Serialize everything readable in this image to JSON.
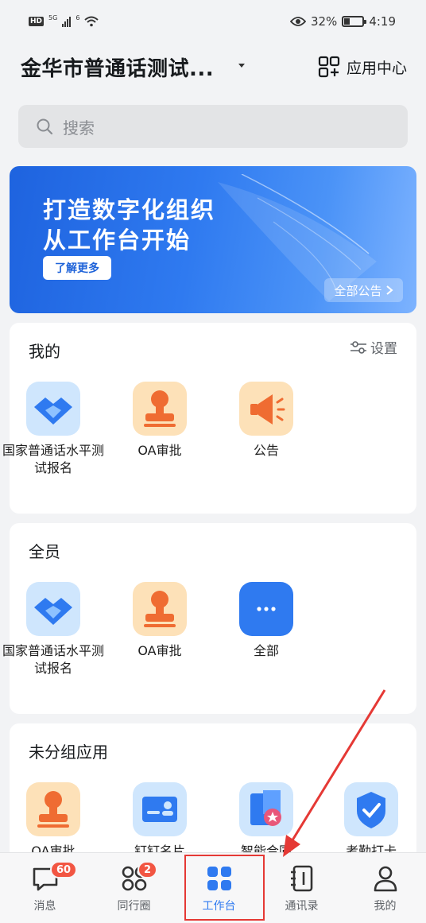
{
  "status_bar": {
    "hd": "HD",
    "sig1": "5G",
    "sig2": "6",
    "battery_text": "32%",
    "battery_level": 0.32,
    "time": "4:19"
  },
  "header": {
    "org_title": "金华市普通话测试...",
    "app_center_label": "应用中心"
  },
  "search": {
    "placeholder": "搜索"
  },
  "banner": {
    "line1": "打造数字化组织",
    "line2": "从工作台开始",
    "learn_more": "了解更多",
    "all_notice": "全部公告"
  },
  "sections": {
    "mine": {
      "title": "我的",
      "settings_label": "设置",
      "apps": [
        {
          "label": "国家普通话水平测试报名",
          "icon": "handshake-icon"
        },
        {
          "label": "OA审批",
          "icon": "stamp-icon"
        },
        {
          "label": "公告",
          "icon": "megaphone-icon"
        }
      ]
    },
    "all_staff": {
      "title": "全员",
      "apps": [
        {
          "label": "国家普通话水平测试报名",
          "icon": "handshake-icon"
        },
        {
          "label": "OA审批",
          "icon": "stamp-icon"
        },
        {
          "label": "全部",
          "icon": "more-icon"
        }
      ]
    },
    "ungrouped": {
      "title": "未分组应用",
      "apps": [
        {
          "label": "OA审批",
          "icon": "stamp-icon"
        },
        {
          "label": "钉钉名片",
          "icon": "id-card-icon"
        },
        {
          "label": "智能合同",
          "icon": "contract-icon"
        },
        {
          "label": "考勤打卡",
          "icon": "check-shield-icon"
        }
      ]
    }
  },
  "tabbar": {
    "tabs": [
      {
        "label": "消息",
        "badge": "60",
        "icon": "chat-bubble-icon"
      },
      {
        "label": "同行圈",
        "badge": "2",
        "icon": "circles-icon"
      },
      {
        "label": "工作台",
        "badge": "",
        "icon": "workbench-grid-icon",
        "active": true
      },
      {
        "label": "通讯录",
        "badge": "",
        "icon": "contacts-book-icon"
      },
      {
        "label": "我的",
        "badge": "",
        "icon": "person-icon"
      }
    ]
  },
  "colors": {
    "accent": "#2f7af0",
    "badge": "#f25643",
    "annotation": "#e53935"
  }
}
